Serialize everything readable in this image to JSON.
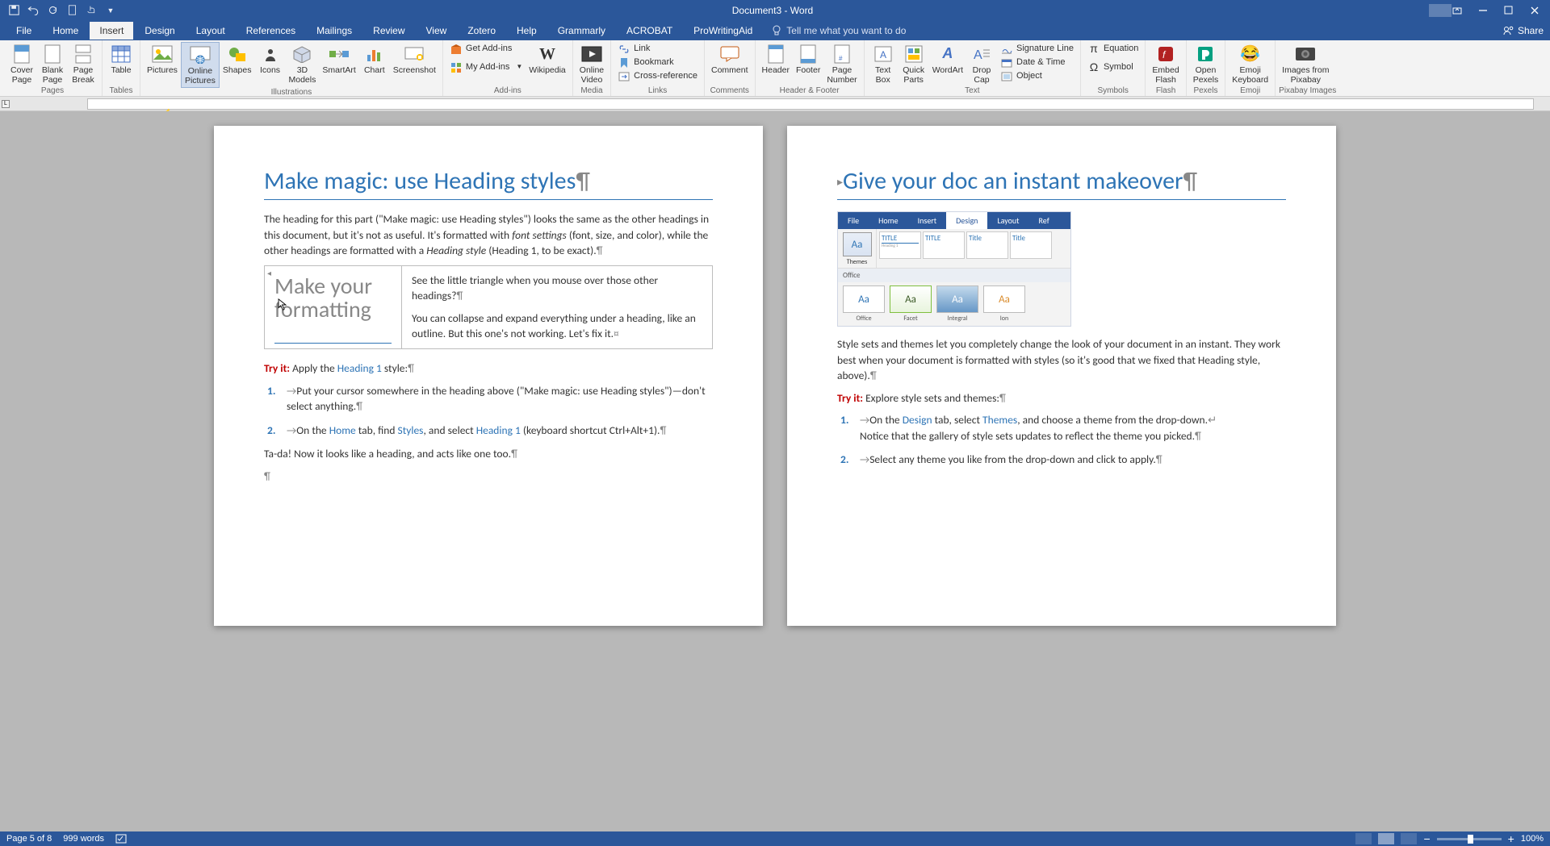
{
  "app": {
    "title": "Document3 - Word"
  },
  "qat": {
    "save": "save",
    "undo": "undo",
    "redo": "redo",
    "new": "new",
    "touch": "touch"
  },
  "tabs": {
    "file": "File",
    "home": "Home",
    "insert": "Insert",
    "design": "Design",
    "layout": "Layout",
    "references": "References",
    "mailings": "Mailings",
    "review": "Review",
    "view": "View",
    "zotero": "Zotero",
    "help": "Help",
    "grammarly": "Grammarly",
    "acrobat": "ACROBAT",
    "prowriting": "ProWritingAid",
    "tellme": "Tell me what you want to do",
    "share": "Share"
  },
  "ribbon": {
    "pages": {
      "label": "Pages",
      "cover": "Cover\nPage",
      "blank": "Blank\nPage",
      "break": "Page\nBreak"
    },
    "tables": {
      "label": "Tables",
      "table": "Table"
    },
    "illustrations": {
      "label": "Illustrations",
      "pictures": "Pictures",
      "online": "Online\nPictures",
      "shapes": "Shapes",
      "icons": "Icons",
      "models": "3D\nModels",
      "smartart": "SmartArt",
      "chart": "Chart",
      "screenshot": "Screenshot"
    },
    "addins": {
      "label": "Add-ins",
      "get": "Get Add-ins",
      "my": "My Add-ins",
      "wikipedia": "Wikipedia"
    },
    "media": {
      "label": "Media",
      "video": "Online\nVideo"
    },
    "links": {
      "label": "Links",
      "link": "Link",
      "bookmark": "Bookmark",
      "cross": "Cross-reference"
    },
    "comments": {
      "label": "Comments",
      "comment": "Comment"
    },
    "headerfooter": {
      "label": "Header & Footer",
      "header": "Header",
      "footer": "Footer",
      "pageno": "Page\nNumber"
    },
    "text": {
      "label": "Text",
      "textbox": "Text\nBox",
      "quick": "Quick\nParts",
      "wordart": "WordArt",
      "drop": "Drop\nCap",
      "sig": "Signature Line",
      "date": "Date & Time",
      "obj": "Object"
    },
    "symbols": {
      "label": "Symbols",
      "eq": "Equation",
      "sym": "Symbol"
    },
    "flash": {
      "label": "Flash",
      "embed": "Embed\nFlash"
    },
    "pexels": {
      "label": "Pexels",
      "open": "Open\nPexels"
    },
    "emoji": {
      "label": "Emoji",
      "kb": "Emoji\nKeyboard"
    },
    "pixabay": {
      "label": "Pixabay Images",
      "img": "Images from\nPixabay"
    }
  },
  "callout": {
    "pictures": "Pictures",
    "online": "Online\nPictures"
  },
  "page_left": {
    "h1": "Make magic: use Heading styles",
    "p1a": "The heading for this part (\"Make magic: use Heading styles\") looks the same as the other headings in this document, but it's not as useful. It's formatted with ",
    "p1b": "font settings",
    "p1c": " (font, size, and color), while the other headings are formatted with a ",
    "p1d": "Heading style",
    "p1e": " (Heading 1, to be exact).",
    "box_left": "Make your formatting",
    "box_r1": "See the little triangle when you mouse over those other headings?",
    "box_r2": "You can collapse and expand everything under a heading, like an outline. But this one's not working. Let's fix it.",
    "tryit": "Try it:",
    "tryrest": " Apply the ",
    "h1style": "Heading 1",
    "styleend": " style:",
    "li1": "Put your cursor somewhere in the heading above (\"Make magic: use Heading styles\")—don't select anything.",
    "li2a": "On the ",
    "home": "Home",
    "li2b": " tab, find ",
    "styles": "Styles",
    "li2c": ", and select ",
    "h1l": "Heading 1",
    "li2d": " (keyboard shortcut Ctrl+Alt+1).",
    "tada": "Ta-da! Now it looks like a heading, and acts like one too."
  },
  "page_right": {
    "h1": "Give your doc an instant makeover",
    "ds": {
      "file": "File",
      "home": "Home",
      "insert": "Insert",
      "design": "Design",
      "layout": "Layout",
      "ref": "Ref",
      "themes": "Themes",
      "title": "TITLE",
      "titlec": "Title",
      "office": "Office",
      "facet": "Facet",
      "integral": "Integral",
      "ion": "Ion",
      "officelbl": "Office"
    },
    "p1": "Style sets and themes let you completely change the look of your document in an instant. They work best when your document is formatted with styles (so it's good that we fixed that Heading style, above).",
    "tryit": "Try it:",
    "tryrest": " Explore style sets and themes:",
    "li1a": "On the ",
    "design": "Design",
    "li1b": " tab, select ",
    "themesw": "Themes",
    "li1c": ", and choose a theme from the drop-down.",
    "li1d": "Notice that the gallery of style sets updates to reflect the theme you picked.",
    "li2": "Select any theme you like from the drop-down and click to apply."
  },
  "status": {
    "page": "Page 5 of 8",
    "words": "999 words",
    "zoom": "100%"
  }
}
